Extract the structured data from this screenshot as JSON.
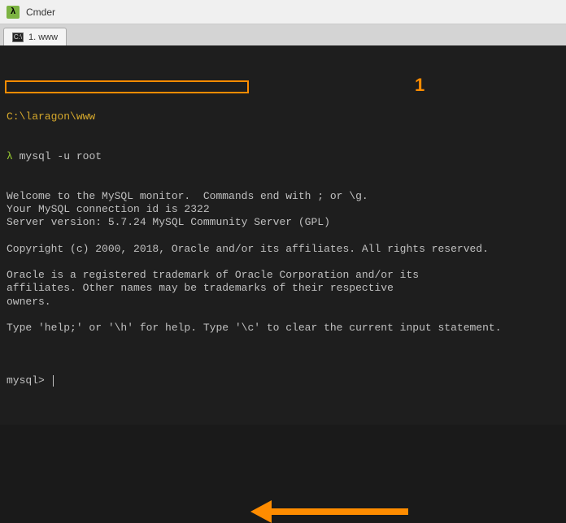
{
  "titlebar": {
    "icon_glyph": "λ",
    "title": "Cmder"
  },
  "tab": {
    "label": "1. www"
  },
  "terminal": {
    "cwd_line": "C:\\laragon\\www",
    "prompt_symbol": "λ",
    "command": "mysql -u root",
    "output_lines": [
      "Welcome to the MySQL monitor.  Commands end with ; or \\g.",
      "Your MySQL connection id is 2322",
      "Server version: 5.7.24 MySQL Community Server (GPL)",
      "",
      "Copyright (c) 2000, 2018, Oracle and/or its affiliates. All rights reserved.",
      "",
      "Oracle is a registered trademark of Oracle Corporation and/or its",
      "affiliates. Other names may be trademarks of their respective",
      "owners.",
      "",
      "Type 'help;' or '\\h' for help. Type '\\c' to clear the current input statement.",
      ""
    ],
    "mysql_prompt": "mysql>"
  },
  "annotation": {
    "number": "1"
  }
}
